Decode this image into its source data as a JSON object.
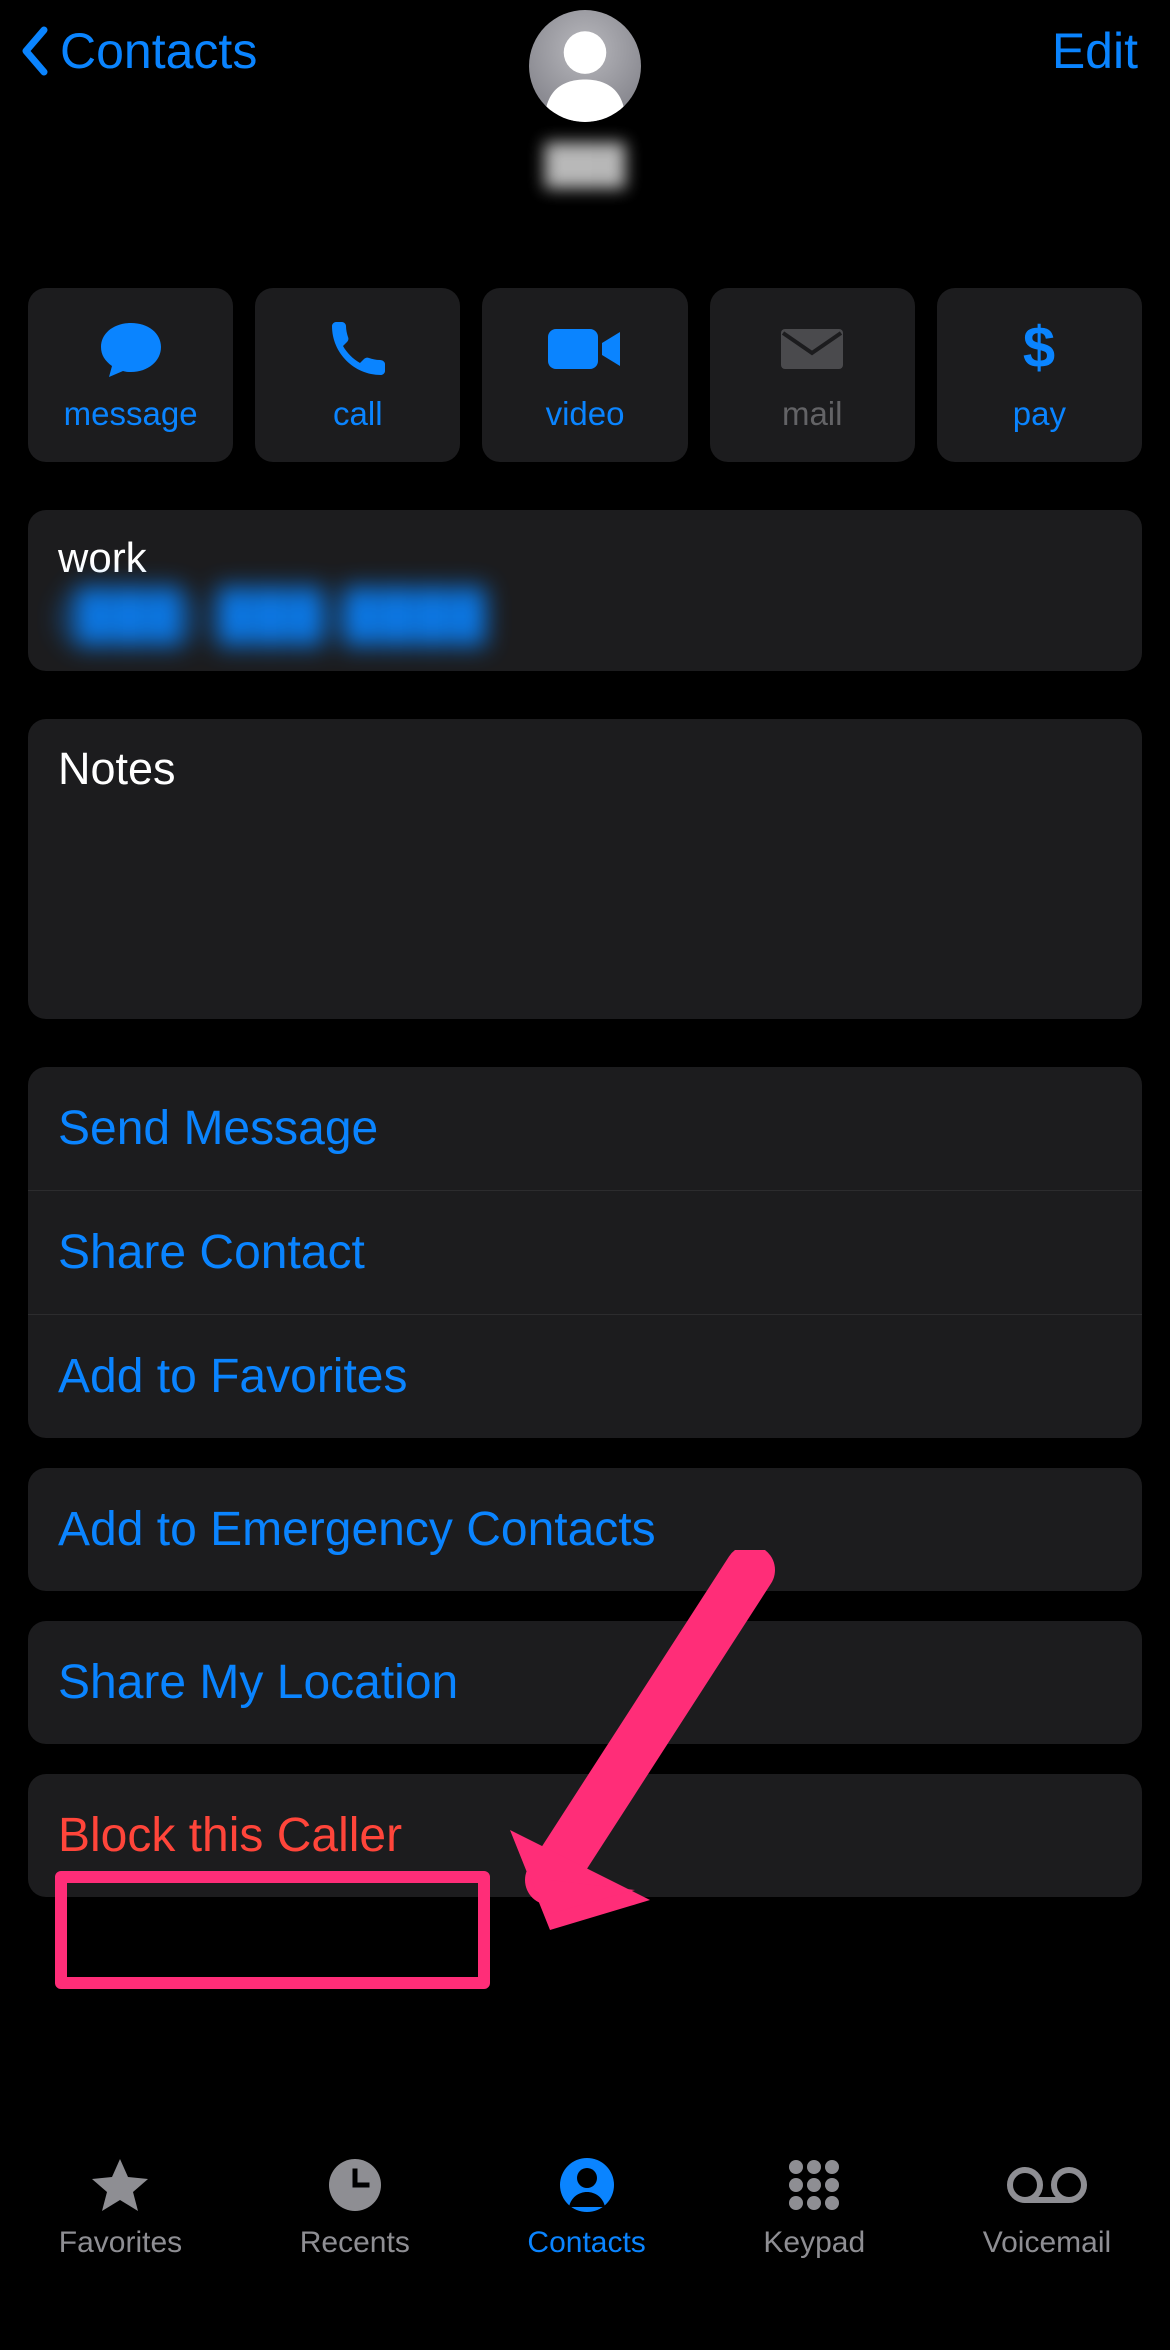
{
  "nav": {
    "back_label": "Contacts",
    "edit_label": "Edit",
    "contact_name": "███"
  },
  "tiles": {
    "message": "message",
    "call": "call",
    "video": "video",
    "mail": "mail",
    "pay": "pay"
  },
  "phone": {
    "type": "work",
    "number": "(███) ███-████"
  },
  "notes": {
    "label": "Notes"
  },
  "actions": {
    "send_message": "Send Message",
    "share_contact": "Share Contact",
    "add_favorites": "Add to Favorites",
    "add_emergency": "Add to Emergency Contacts",
    "share_location": "Share My Location",
    "block_caller": "Block this Caller"
  },
  "tabs": {
    "favorites": "Favorites",
    "recents": "Recents",
    "contacts": "Contacts",
    "keypad": "Keypad",
    "voicemail": "Voicemail"
  }
}
